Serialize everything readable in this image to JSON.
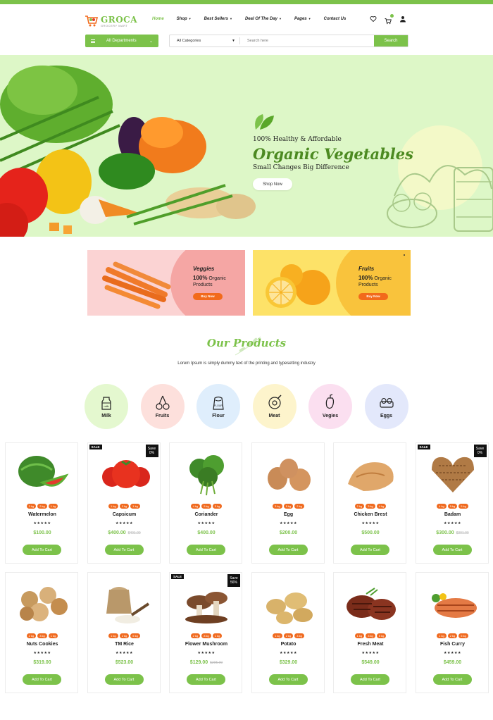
{
  "brand": {
    "name": "GROCA",
    "tagline": "GROCERY MART",
    "accent": "#7cc24a"
  },
  "nav": [
    {
      "label": "Home",
      "active": true,
      "dropdown": false
    },
    {
      "label": "Shop",
      "active": false,
      "dropdown": true
    },
    {
      "label": "Best Sellers",
      "active": false,
      "dropdown": true
    },
    {
      "label": "Deal Of The Day",
      "active": false,
      "dropdown": true
    },
    {
      "label": "Pages",
      "active": false,
      "dropdown": true
    },
    {
      "label": "Contact Us",
      "active": false,
      "dropdown": false
    }
  ],
  "header_icons": [
    "heart-icon",
    "cart-icon",
    "user-icon"
  ],
  "departments": {
    "label": "All Departments"
  },
  "search": {
    "category": "All Categories",
    "placeholder": "Search here",
    "button": "Search"
  },
  "hero": {
    "pre": "100% Healthy & Affordable",
    "title": "Organic Vegetables",
    "subtitle": "Small Changes Big Difference",
    "button": "Shop Now"
  },
  "promos": [
    {
      "title": "Veggies",
      "percent": "100%",
      "line1": "Organic",
      "line2": "Products",
      "button": "Buy Now"
    },
    {
      "title": "Fruits",
      "percent": "100%",
      "line1": "Organic",
      "line2": "Products",
      "button": "Buy Now"
    }
  ],
  "products_section": {
    "title": "Our Products",
    "description": "Lorem Ipsum is simply dummy text of the printing and typesetting industry"
  },
  "categories": [
    {
      "label": "Milk",
      "icon": "milk-icon",
      "color": "#e4f8cf"
    },
    {
      "label": "Fruits",
      "icon": "cherries-icon",
      "color": "#fde0dc"
    },
    {
      "label": "Flour",
      "icon": "flour-sack-icon",
      "color": "#dfeefc"
    },
    {
      "label": "Meat",
      "icon": "ham-icon",
      "color": "#fdf4cc"
    },
    {
      "label": "Vegies",
      "icon": "pepper-icon",
      "color": "#fbdff0"
    },
    {
      "label": "Eggs",
      "icon": "egg-tray-icon",
      "color": "#e3e8fb"
    }
  ],
  "products": [
    {
      "name": "Watermelon",
      "weights": [
        "3 kg",
        "2 kg",
        "1 kg"
      ],
      "stars": "★★★★★",
      "price": "$100.00",
      "old_price": "",
      "sale": "",
      "save": "",
      "save_pct": "",
      "button": "Add To Cart",
      "img": "watermelon"
    },
    {
      "name": "Capsicum",
      "weights": [
        "1 kg",
        "3 kg",
        "1 kg"
      ],
      "stars": "★★★★★",
      "price": "$400.00",
      "old_price": "$401.00",
      "sale": "SALE",
      "save": "Save",
      "save_pct": "0%",
      "button": "Add To Cart",
      "img": "tomato"
    },
    {
      "name": "Coriander",
      "weights": [
        "4 kg",
        "5 kg",
        "3 kg"
      ],
      "stars": "★★★★★",
      "price": "$400.00",
      "old_price": "",
      "sale": "",
      "save": "",
      "save_pct": "",
      "button": "Add To Cart",
      "img": "coriander"
    },
    {
      "name": "Egg",
      "weights": [
        "3 kg",
        "5 kg",
        "2 kg"
      ],
      "stars": "★★★★★",
      "price": "$200.00",
      "old_price": "",
      "sale": "",
      "save": "",
      "save_pct": "",
      "button": "Add To Cart",
      "img": "egg"
    },
    {
      "name": "Chicken Brest",
      "weights": [
        "2 kg",
        "3 kg",
        "4 kg"
      ],
      "stars": "★★★★★",
      "price": "$500.00",
      "old_price": "",
      "sale": "",
      "save": "",
      "save_pct": "",
      "button": "Add To Cart",
      "img": "chicken"
    },
    {
      "name": "Badam",
      "weights": [
        "4 kg",
        "5 kg",
        "5 kg"
      ],
      "stars": "★★★★★",
      "price": "$300.00",
      "old_price": "$301.00",
      "sale": "SALE",
      "save": "Save",
      "save_pct": "0%",
      "button": "Add To Cart",
      "img": "almond"
    },
    {
      "name": "Nuts Cookies",
      "weights": [
        "2 kg",
        "3 kg",
        "1 kg"
      ],
      "stars": "★★★★★",
      "price": "$319.00",
      "old_price": "",
      "sale": "",
      "save": "",
      "save_pct": "",
      "button": "Add To Cart",
      "img": "cookies"
    },
    {
      "name": "TM Rice",
      "weights": [
        "1 kg",
        "2 kg",
        "5 kg"
      ],
      "stars": "★★★★★",
      "price": "$523.00",
      "old_price": "",
      "sale": "",
      "save": "",
      "save_pct": "",
      "button": "Add To Cart",
      "img": "rice"
    },
    {
      "name": "Flower Mushroom",
      "weights": [
        "2 kg",
        "8 kg",
        "1 kg"
      ],
      "stars": "★★★★★",
      "price": "$129.00",
      "old_price": "$295.00",
      "sale": "SALE",
      "save": "Save",
      "save_pct": "56%",
      "button": "Add To Cart",
      "img": "mushroom"
    },
    {
      "name": "Potato",
      "weights": [
        "1 kg",
        "2 kg",
        "3 kg"
      ],
      "stars": "★★★★★",
      "price": "$329.00",
      "old_price": "",
      "sale": "",
      "save": "",
      "save_pct": "",
      "button": "Add To Cart",
      "img": "potato"
    },
    {
      "name": "Fresh Meat",
      "weights": [
        "1 kg",
        "3 kg",
        "5 kg"
      ],
      "stars": "★★★★★",
      "price": "$549.00",
      "old_price": "",
      "sale": "",
      "save": "",
      "save_pct": "",
      "button": "Add To Cart",
      "img": "meat"
    },
    {
      "name": "Fish Curry",
      "weights": [
        "1 kg",
        "2 kg",
        "5 kg"
      ],
      "stars": "★★★★★",
      "price": "$459.00",
      "old_price": "",
      "sale": "",
      "save": "",
      "save_pct": "",
      "button": "Add To Cart",
      "img": "fish"
    }
  ]
}
